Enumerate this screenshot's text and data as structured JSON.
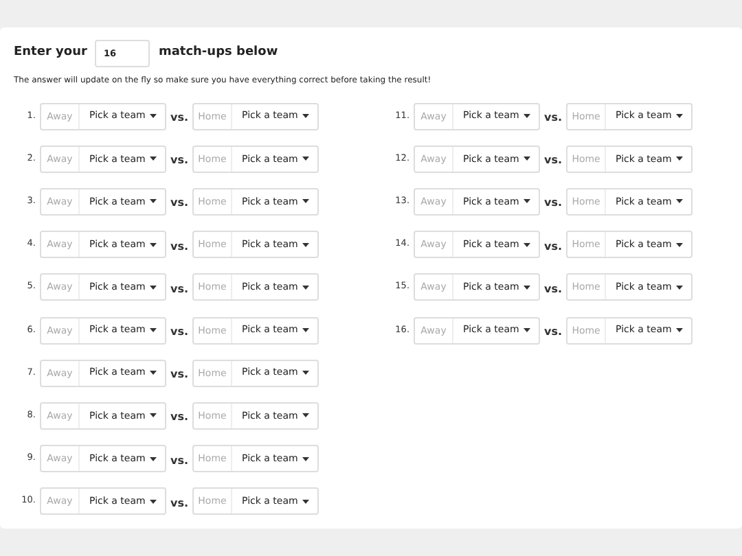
{
  "heading": {
    "before": "Enter your",
    "count": "16",
    "after": "match-ups below"
  },
  "note": "The answer will update on the fly so make sure you have everything correct before taking the result!",
  "columns": [
    {
      "matchups": [
        {
          "number": "1.",
          "away_label": "Away",
          "away_pick": "Pick a team",
          "vs": "vs.",
          "home_label": "Home",
          "home_pick": "Pick a team"
        },
        {
          "number": "2.",
          "away_label": "Away",
          "away_pick": "Pick a team",
          "vs": "vs.",
          "home_label": "Home",
          "home_pick": "Pick a team"
        },
        {
          "number": "3.",
          "away_label": "Away",
          "away_pick": "Pick a team",
          "vs": "vs.",
          "home_label": "Home",
          "home_pick": "Pick a team"
        },
        {
          "number": "4.",
          "away_label": "Away",
          "away_pick": "Pick a team",
          "vs": "vs.",
          "home_label": "Home",
          "home_pick": "Pick a team"
        },
        {
          "number": "5.",
          "away_label": "Away",
          "away_pick": "Pick a team",
          "vs": "vs.",
          "home_label": "Home",
          "home_pick": "Pick a team"
        },
        {
          "number": "6.",
          "away_label": "Away",
          "away_pick": "Pick a team",
          "vs": "vs.",
          "home_label": "Home",
          "home_pick": "Pick a team"
        },
        {
          "number": "7.",
          "away_label": "Away",
          "away_pick": "Pick a team",
          "vs": "vs.",
          "home_label": "Home",
          "home_pick": "Pick a team"
        },
        {
          "number": "8.",
          "away_label": "Away",
          "away_pick": "Pick a team",
          "vs": "vs.",
          "home_label": "Home",
          "home_pick": "Pick a team"
        },
        {
          "number": "9.",
          "away_label": "Away",
          "away_pick": "Pick a team",
          "vs": "vs.",
          "home_label": "Home",
          "home_pick": "Pick a team"
        },
        {
          "number": "10.",
          "away_label": "Away",
          "away_pick": "Pick a team",
          "vs": "vs.",
          "home_label": "Home",
          "home_pick": "Pick a team"
        }
      ]
    },
    {
      "matchups": [
        {
          "number": "11.",
          "away_label": "Away",
          "away_pick": "Pick a team",
          "vs": "vs.",
          "home_label": "Home",
          "home_pick": "Pick a team"
        },
        {
          "number": "12.",
          "away_label": "Away",
          "away_pick": "Pick a team",
          "vs": "vs.",
          "home_label": "Home",
          "home_pick": "Pick a team"
        },
        {
          "number": "13.",
          "away_label": "Away",
          "away_pick": "Pick a team",
          "vs": "vs.",
          "home_label": "Home",
          "home_pick": "Pick a team"
        },
        {
          "number": "14.",
          "away_label": "Away",
          "away_pick": "Pick a team",
          "vs": "vs.",
          "home_label": "Home",
          "home_pick": "Pick a team"
        },
        {
          "number": "15.",
          "away_label": "Away",
          "away_pick": "Pick a team",
          "vs": "vs.",
          "home_label": "Home",
          "home_pick": "Pick a team"
        },
        {
          "number": "16.",
          "away_label": "Away",
          "away_pick": "Pick a team",
          "vs": "vs.",
          "home_label": "Home",
          "home_pick": "Pick a team"
        }
      ]
    }
  ]
}
